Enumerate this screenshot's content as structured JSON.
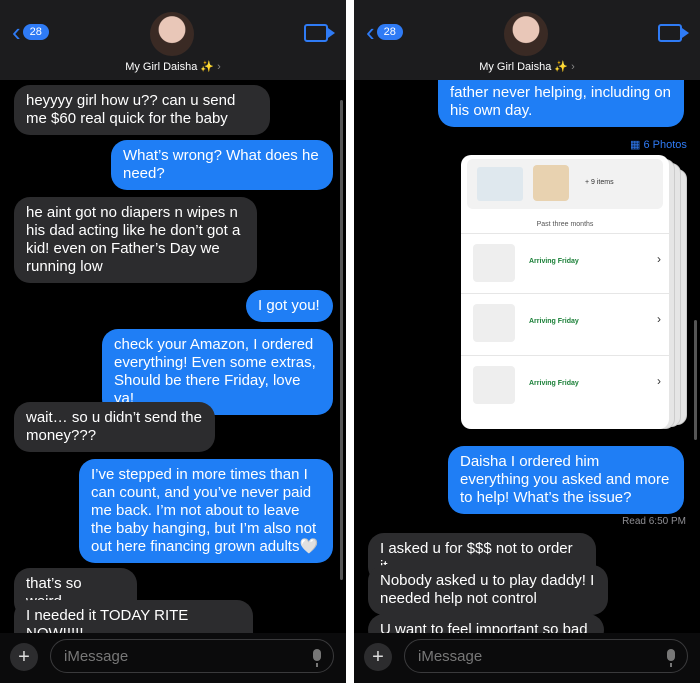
{
  "header": {
    "back_count": "28",
    "contact_name": "My Girl Daisha ✨",
    "contact_chevron": "›"
  },
  "left": {
    "messages": [
      {
        "text": "heyyyy girl how u?? can u send me $60 real quick for the baby"
      },
      {
        "text": "What’s wrong? What does he need?"
      },
      {
        "text": "he aint got no diapers n wipes n his dad acting like he don’t got a kid! even on Father’s Day we running low"
      },
      {
        "text": "I got you!"
      },
      {
        "text": "check your Amazon, I ordered everything! Even some extras, Should be there Friday, love ya!"
      },
      {
        "text": "wait… so u didn’t send the money???"
      },
      {
        "text": "I’ve stepped in more times than I can count, and you’ve never paid me back. I’m not about to leave the baby hanging, but I’m also not out here financing grown adults🤍"
      },
      {
        "text": "that’s so weird."
      },
      {
        "text": "I needed it TODAY RITE NOW!!!!!"
      }
    ]
  },
  "right": {
    "top_partial_text": "father never helping, including on his own day.",
    "photos_label": "6 Photos",
    "amazon": {
      "items_count": "+ 9 items",
      "past_label": "Past three months",
      "rows": [
        {
          "status": "Arriving Friday"
        },
        {
          "status": "Arriving Friday"
        },
        {
          "status": "Arriving Friday"
        }
      ]
    },
    "messages": [
      {
        "text": "Daisha I ordered him everything you asked and more to help! What’s the issue?"
      },
      {
        "text": "I asked u for $$$ not to order it"
      },
      {
        "text": "Nobody asked u to play daddy! I needed help not control"
      },
      {
        "text": "U want to feel important so bad"
      }
    ],
    "read_receipt": "Read 6:50 PM"
  },
  "composer": {
    "placeholder": "iMessage",
    "plus": "+"
  },
  "colors": {
    "outgoing": "#1f7ef5",
    "incoming": "#2c2c2e",
    "accent": "#2f7bf5"
  }
}
